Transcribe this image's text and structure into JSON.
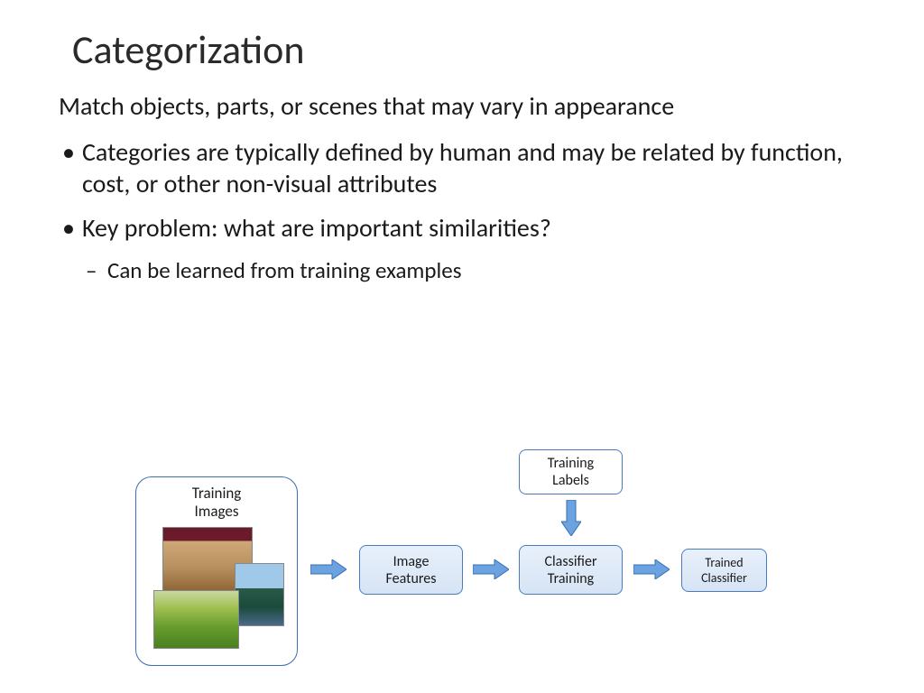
{
  "title": "Categorization",
  "subtitle": "Match objects, parts, or scenes that may vary in appearance",
  "bullets": {
    "b1": "Categories are typically defined by human and may be related by function, cost, or other non-visual attributes",
    "b2": "Key problem: what are important similarities?",
    "b2_sub": "Can be learned from training examples"
  },
  "diagram": {
    "training_images": "Training\nImages",
    "image_features": "Image\nFeatures",
    "training_labels": "Training\nLabels",
    "classifier_training": "Classifier\nTraining",
    "trained_classifier": "Trained\nClassifier"
  }
}
